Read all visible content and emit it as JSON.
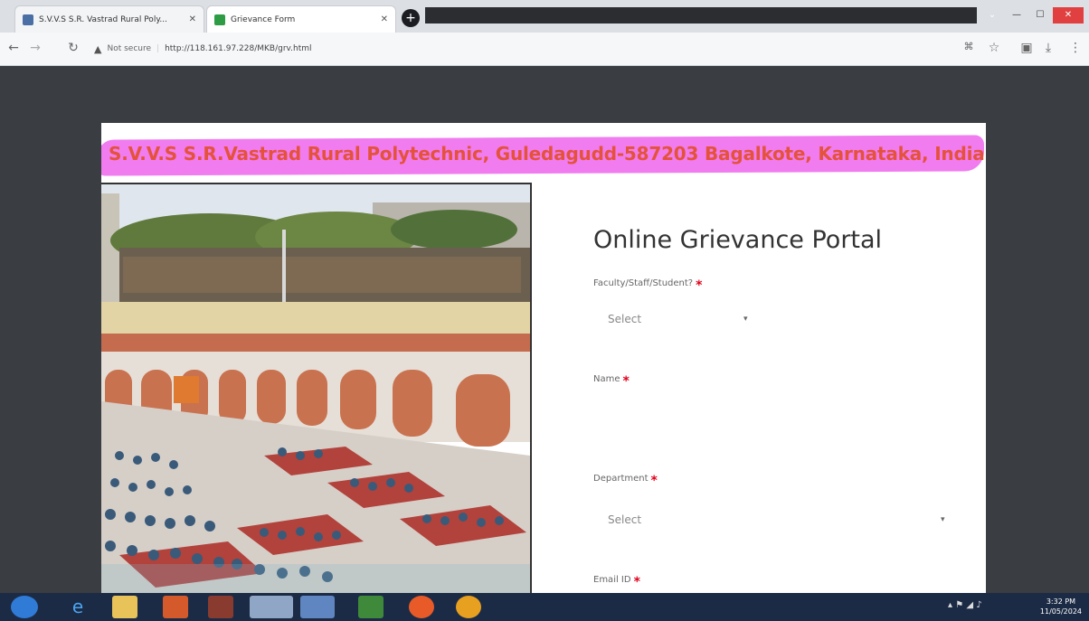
{
  "browser": {
    "tabs": [
      {
        "title": "S.V.V.S S.R. Vastrad Rural Poly...",
        "favicon_color": "#4a6fa5"
      },
      {
        "title": "Grievance Form",
        "favicon_color": "#2e9c44"
      }
    ],
    "new_tab_label": "+",
    "address": {
      "security_label": "Not secure",
      "url": "http://118.161.97.228/MKB/grv.html"
    }
  },
  "banner": {
    "text": "S.V.V.S S.R.Vastrad Rural Polytechnic, Guledagudd-587203 Bagalkote, Karnataka, India",
    "highlight_color": "#f07cf0",
    "text_color": "#e4523a"
  },
  "form": {
    "title": "Online Grievance Portal",
    "fields": [
      {
        "label": "Faculty/Staff/Student?",
        "required_mark": "*",
        "value": "Select"
      },
      {
        "label": "Name",
        "required_mark": "*"
      },
      {
        "label": "Department",
        "required_mark": "*",
        "value": "Select"
      },
      {
        "label": "Email ID",
        "required_mark": "*"
      }
    ]
  },
  "taskbar": {
    "clock_time": "3:32 PM",
    "clock_date": "11/05/2024"
  }
}
